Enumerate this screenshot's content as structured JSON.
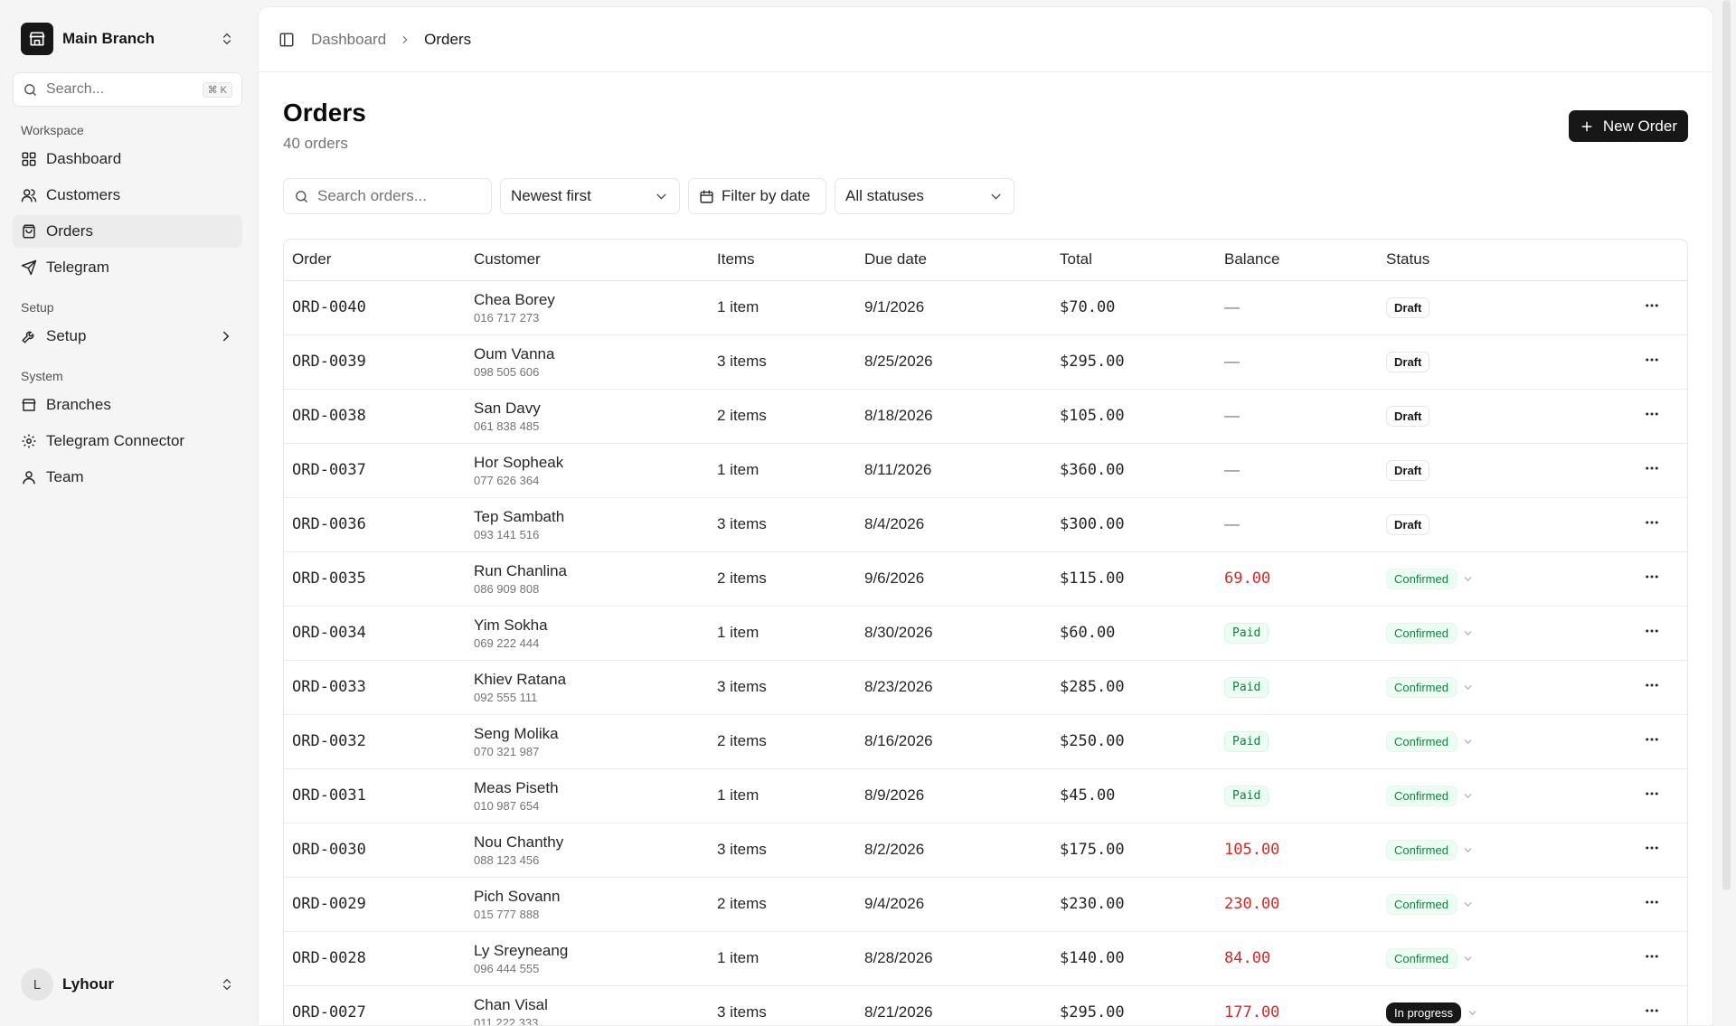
{
  "sidebar": {
    "branch": "Main Branch",
    "search_placeholder": "Search...",
    "search_shortcut": "⌘ K",
    "sections": {
      "workspace": "Workspace",
      "setup": "Setup",
      "system": "System"
    },
    "items": {
      "dashboard": "Dashboard",
      "customers": "Customers",
      "orders": "Orders",
      "telegram": "Telegram",
      "setup": "Setup",
      "branches": "Branches",
      "telegram_connector": "Telegram Connector",
      "team": "Team"
    },
    "user": {
      "initial": "L",
      "name": "Lyhour"
    }
  },
  "breadcrumb": {
    "parent": "Dashboard",
    "current": "Orders"
  },
  "page": {
    "title": "Orders",
    "subtitle": "40 orders",
    "new_button": "New Order"
  },
  "filters": {
    "search_placeholder": "Search orders...",
    "sort": "Newest first",
    "date": "Filter by date",
    "status": "All statuses"
  },
  "table": {
    "headers": {
      "order": "Order",
      "customer": "Customer",
      "items": "Items",
      "due": "Due date",
      "total": "Total",
      "balance": "Balance",
      "status": "Status"
    },
    "rows": [
      {
        "order": "ORD-0040",
        "name": "Chea Borey",
        "phone": "016 717 273",
        "items": "1 item",
        "due": "9/1/2026",
        "total": "$70.00",
        "balance": "—",
        "status": "Draft"
      },
      {
        "order": "ORD-0039",
        "name": "Oum Vanna",
        "phone": "098 505 606",
        "items": "3 items",
        "due": "8/25/2026",
        "total": "$295.00",
        "balance": "—",
        "status": "Draft"
      },
      {
        "order": "ORD-0038",
        "name": "San Davy",
        "phone": "061 838 485",
        "items": "2 items",
        "due": "8/18/2026",
        "total": "$105.00",
        "balance": "—",
        "status": "Draft"
      },
      {
        "order": "ORD-0037",
        "name": "Hor Sopheak",
        "phone": "077 626 364",
        "items": "1 item",
        "due": "8/11/2026",
        "total": "$360.00",
        "balance": "—",
        "status": "Draft"
      },
      {
        "order": "ORD-0036",
        "name": "Tep Sambath",
        "phone": "093 141 516",
        "items": "3 items",
        "due": "8/4/2026",
        "total": "$300.00",
        "balance": "—",
        "status": "Draft"
      },
      {
        "order": "ORD-0035",
        "name": "Run Chanlina",
        "phone": "086 909 808",
        "items": "2 items",
        "due": "9/6/2026",
        "total": "$115.00",
        "balance": "69.00",
        "status": "Confirmed"
      },
      {
        "order": "ORD-0034",
        "name": "Yim Sokha",
        "phone": "069 222 444",
        "items": "1 item",
        "due": "8/30/2026",
        "total": "$60.00",
        "balance": "Paid",
        "status": "Confirmed"
      },
      {
        "order": "ORD-0033",
        "name": "Khiev Ratana",
        "phone": "092 555 111",
        "items": "3 items",
        "due": "8/23/2026",
        "total": "$285.00",
        "balance": "Paid",
        "status": "Confirmed"
      },
      {
        "order": "ORD-0032",
        "name": "Seng Molika",
        "phone": "070 321 987",
        "items": "2 items",
        "due": "8/16/2026",
        "total": "$250.00",
        "balance": "Paid",
        "status": "Confirmed"
      },
      {
        "order": "ORD-0031",
        "name": "Meas Piseth",
        "phone": "010 987 654",
        "items": "1 item",
        "due": "8/9/2026",
        "total": "$45.00",
        "balance": "Paid",
        "status": "Confirmed"
      },
      {
        "order": "ORD-0030",
        "name": "Nou Chanthy",
        "phone": "088 123 456",
        "items": "3 items",
        "due": "8/2/2026",
        "total": "$175.00",
        "balance": "105.00",
        "status": "Confirmed"
      },
      {
        "order": "ORD-0029",
        "name": "Pich Sovann",
        "phone": "015 777 888",
        "items": "2 items",
        "due": "9/4/2026",
        "total": "$230.00",
        "balance": "230.00",
        "status": "Confirmed"
      },
      {
        "order": "ORD-0028",
        "name": "Ly Sreyneang",
        "phone": "096 444 555",
        "items": "1 item",
        "due": "8/28/2026",
        "total": "$140.00",
        "balance": "84.00",
        "status": "Confirmed"
      },
      {
        "order": "ORD-0027",
        "name": "Chan Visal",
        "phone": "011 222 333",
        "items": "3 items",
        "due": "8/21/2026",
        "total": "$295.00",
        "balance": "177.00",
        "status": "In progress"
      }
    ]
  },
  "colors": {
    "primary": "#171717",
    "balance_due": "#dc2626",
    "paid": "#15803d",
    "confirmed_bg": "#ecfdf3"
  }
}
